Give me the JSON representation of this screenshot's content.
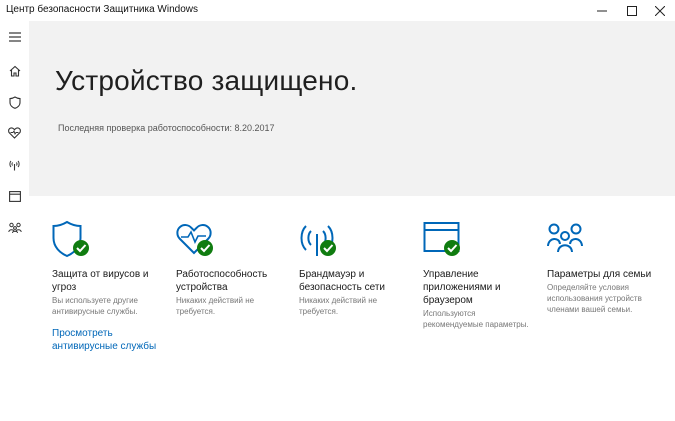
{
  "window": {
    "title": "Центр безопасности Защитника Windows"
  },
  "icons": {
    "menu": "hamburger-icon",
    "home": "home-icon",
    "shield": "shield-icon",
    "health": "heart-icon",
    "network": "wireless-icon",
    "app": "browser-window-icon",
    "family": "family-icon",
    "check": "check-badge-icon"
  },
  "colors": {
    "accent": "#0067b8",
    "check_green": "#107c10",
    "hero_bg": "#f2f2f2"
  },
  "hero": {
    "title": "Устройство защищено.",
    "last_check_label": "Последняя проверка работоспособности:",
    "last_check_date": "8.20.2017"
  },
  "tiles": [
    {
      "title": "Защита от вирусов и угроз",
      "desc": "Вы используете другие антивирусные службы.",
      "link": "Просмотреть антивирусные службы"
    },
    {
      "title": "Работоспособность устройства",
      "desc": "Никаких действий не требуется."
    },
    {
      "title": "Брандмауэр и безопасность сети",
      "desc": "Никаких действий не требуется."
    },
    {
      "title": "Управление приложениями и браузером",
      "desc": "Используются рекомендуемые параметры."
    },
    {
      "title": "Параметры для семьи",
      "desc": "Определяйте условия использования устройств членами вашей семьи."
    }
  ]
}
